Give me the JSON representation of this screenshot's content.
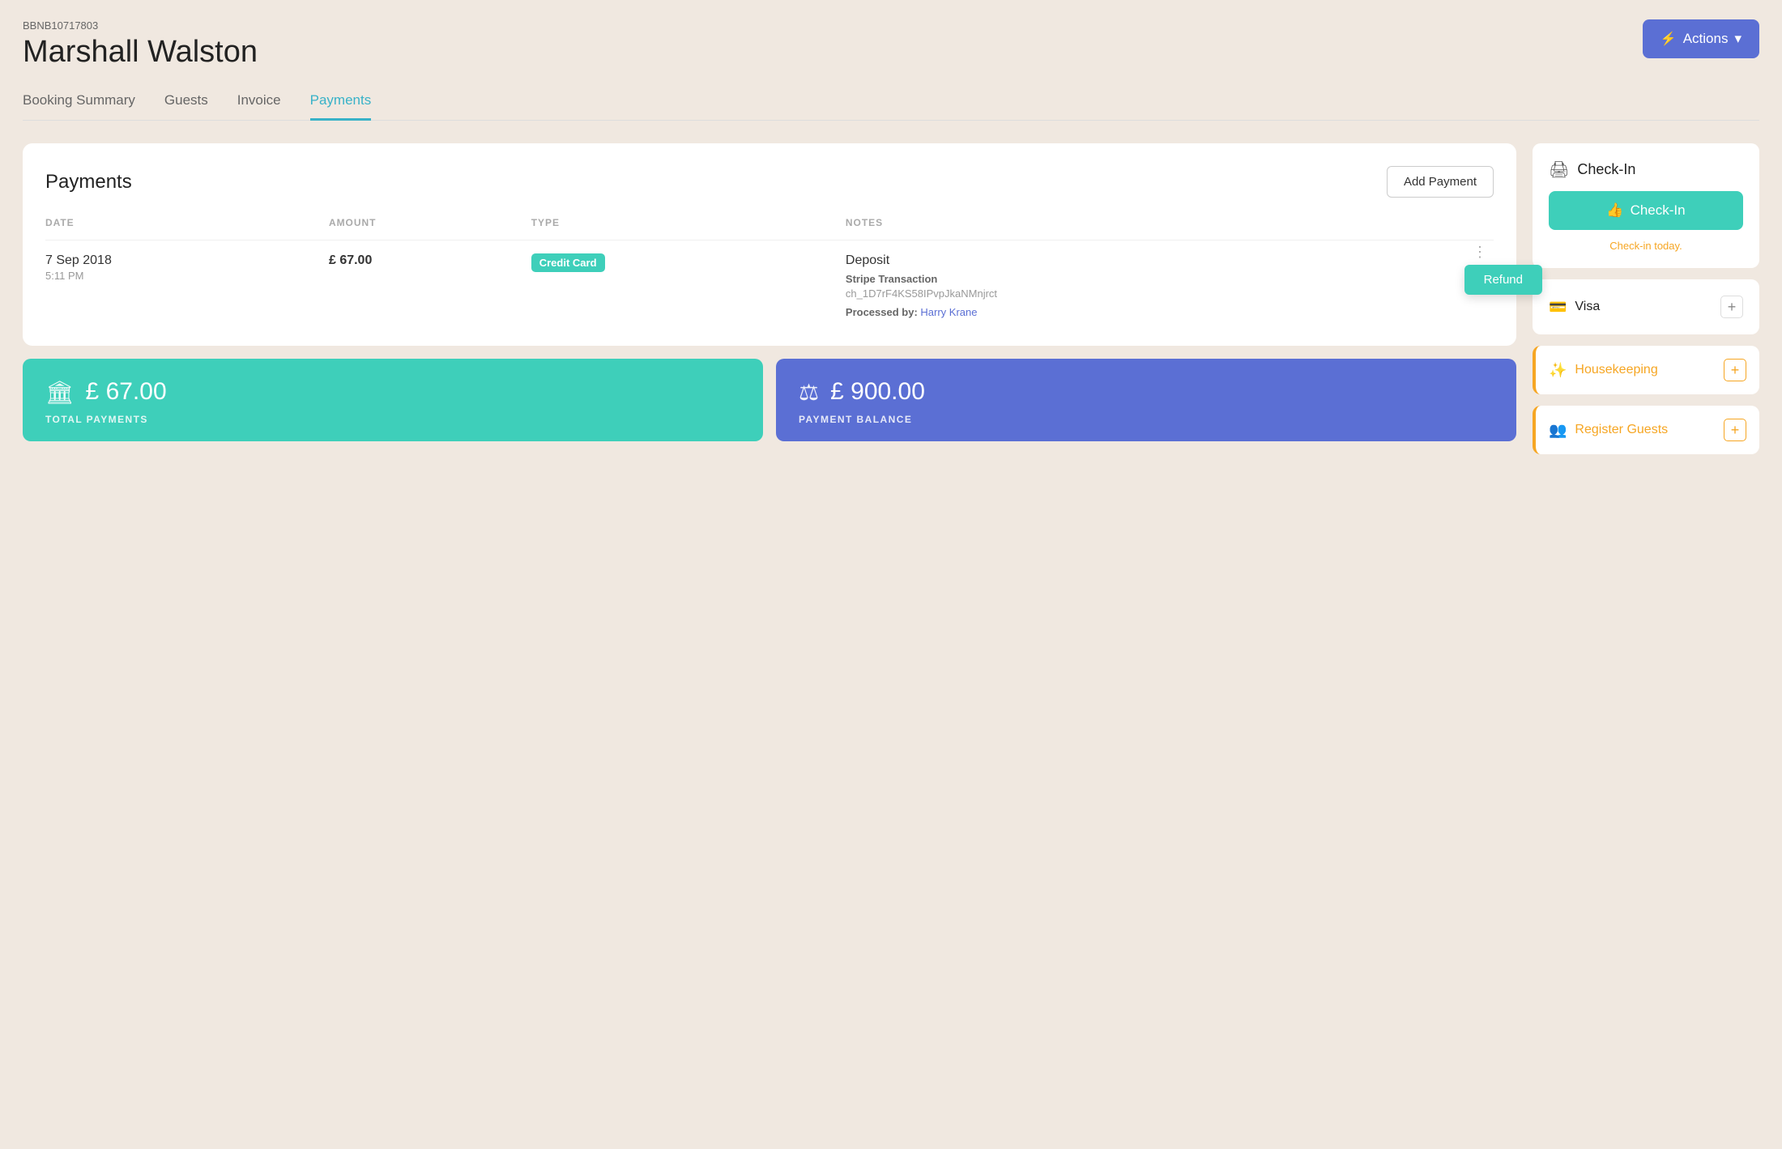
{
  "header": {
    "booking_id": "BBNB10717803",
    "guest_name": "Marshall Walston",
    "actions_label": "Actions",
    "actions_icon": "⚡"
  },
  "tabs": [
    {
      "id": "booking-summary",
      "label": "Booking Summary",
      "active": false
    },
    {
      "id": "guests",
      "label": "Guests",
      "active": false
    },
    {
      "id": "invoice",
      "label": "Invoice",
      "active": false
    },
    {
      "id": "payments",
      "label": "Payments",
      "active": true
    }
  ],
  "payments_card": {
    "title": "Payments",
    "add_payment_label": "Add Payment",
    "columns": [
      "DATE",
      "AMOUNT",
      "TYPE",
      "NOTES"
    ],
    "rows": [
      {
        "date": "7 Sep 2018",
        "time": "5:11 PM",
        "amount": "£ 67.00",
        "type": "Credit Card",
        "notes_title": "Deposit",
        "stripe_label": "Stripe Transaction",
        "stripe_txn": "ch_1D7rF4KS58IPvpJkaNMnjrct",
        "processed_by_label": "Processed by:",
        "processed_by_name": "Harry Krane"
      }
    ],
    "refund_label": "Refund"
  },
  "summary_cards": [
    {
      "id": "total-payments",
      "color": "green",
      "icon": "🏛",
      "amount": "£ 67.00",
      "label": "TOTAL PAYMENTS"
    },
    {
      "id": "payment-balance",
      "color": "blue",
      "icon": "⚖",
      "amount": "£ 900.00",
      "label": "PAYMENT BALANCE"
    }
  ],
  "sidebar": {
    "checkin_card": {
      "icon": "🖨",
      "title": "Check-In",
      "button_label": "Check-In",
      "button_icon": "👍",
      "checkin_text": "Check-in",
      "checkin_highlight": "today",
      "checkin_suffix": "."
    },
    "visa_card": {
      "icon": "💳",
      "label": "Visa",
      "plus_label": "+"
    },
    "housekeeping": {
      "icon": "✨",
      "label": "Housekeeping",
      "plus_label": "+"
    },
    "register_guests": {
      "icon": "👥",
      "label": "Register Guests",
      "plus_label": "+"
    }
  }
}
